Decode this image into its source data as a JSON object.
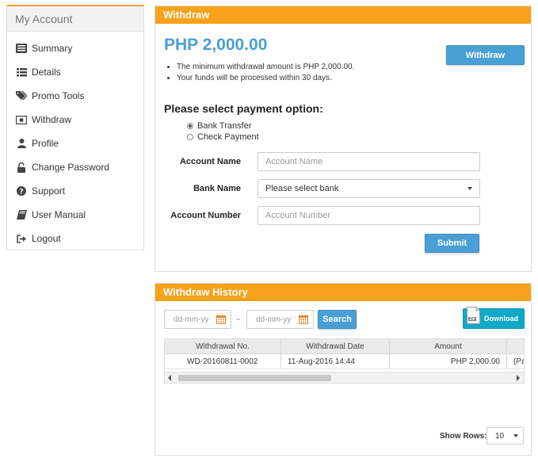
{
  "sidebar": {
    "title": "My Account",
    "items": [
      {
        "label": "Summary",
        "icon": "summary-icon"
      },
      {
        "label": "Details",
        "icon": "list-icon"
      },
      {
        "label": "Promo Tools",
        "icon": "tags-icon"
      },
      {
        "label": "Withdraw",
        "icon": "money-icon"
      },
      {
        "label": "Profile",
        "icon": "user-icon"
      },
      {
        "label": "Change Password",
        "icon": "unlock-icon"
      },
      {
        "label": "Support",
        "icon": "question-icon"
      },
      {
        "label": "User Manual",
        "icon": "book-icon"
      },
      {
        "label": "Logout",
        "icon": "sign-out-icon"
      }
    ]
  },
  "withdraw": {
    "header": "Withdraw",
    "amount": "PHP 2,000.00",
    "notes": [
      "The minimum withdrawal amount is PHP 2,000.00.",
      "Your funds will be processed within 30 days."
    ],
    "withdraw_button": "Withdraw",
    "payment_title": "Please select payment option:",
    "options": [
      {
        "label": "Bank Transfer",
        "selected": true
      },
      {
        "label": "Check Payment",
        "selected": false
      }
    ],
    "form": {
      "account_name_label": "Account Name",
      "account_name_placeholder": "Account Name",
      "bank_name_label": "Bank Name",
      "bank_name_value": "Please select bank",
      "account_number_label": "Account Number",
      "account_number_placeholder": "Account Number"
    },
    "submit_button": "Submit"
  },
  "history": {
    "header": "Withdraw History",
    "date_from_placeholder": "dd-mm-yy",
    "date_separator": "-",
    "date_to_placeholder": "dd-mm-yy",
    "search_button": "Search",
    "download_button": "Download",
    "zip_label": "ZIP",
    "columns": [
      "Withdrawal No.",
      "Withdrawal Date",
      "Amount",
      ""
    ],
    "rows": [
      {
        "no": "WD-20160811-0002",
        "date": "11-Aug-2016 14:44",
        "amount": "PHP 2,000.00",
        "extra": "(Pa"
      }
    ],
    "show_rows_label": "Show Rows:",
    "show_rows_value": "10"
  },
  "colors": {
    "accent": "#f7a21b",
    "primary": "#4a9fd4",
    "download": "#10a9c8"
  }
}
